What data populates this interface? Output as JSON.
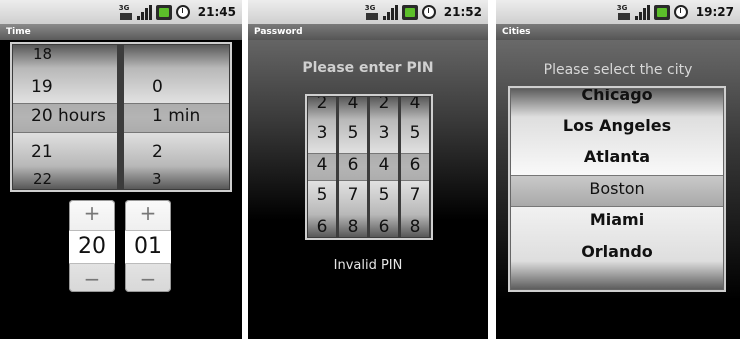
{
  "screens": [
    {
      "clock": "21:45",
      "title": "Time",
      "hours": [
        "18",
        "19",
        "20 hours",
        "21",
        "22"
      ],
      "minutes": [
        "",
        "0",
        "1 min",
        "2",
        "3"
      ],
      "stepper_hours": {
        "plus": "+",
        "value": "20",
        "minus": "−"
      },
      "stepper_minutes": {
        "plus": "+",
        "value": "01",
        "minus": "−"
      }
    },
    {
      "clock": "21:52",
      "title": "Password",
      "prompt": "Please enter PIN",
      "pin_wheels": [
        [
          "2",
          "3",
          "4",
          "5",
          "6"
        ],
        [
          "4",
          "5",
          "6",
          "7",
          "8"
        ],
        [
          "2",
          "3",
          "4",
          "5",
          "6"
        ],
        [
          "4",
          "5",
          "6",
          "7",
          "8"
        ]
      ],
      "message": "Invalid PIN"
    },
    {
      "clock": "19:27",
      "title": "Cities",
      "prompt": "Please select the city",
      "cities": [
        "Chicago",
        "Los Angeles",
        "Atlanta",
        "Boston",
        "Miami",
        "Orlando"
      ]
    }
  ],
  "status_icons": {
    "network": "3G",
    "names": [
      "3g-icon",
      "signal-icon",
      "battery-icon",
      "alarm-icon"
    ]
  }
}
